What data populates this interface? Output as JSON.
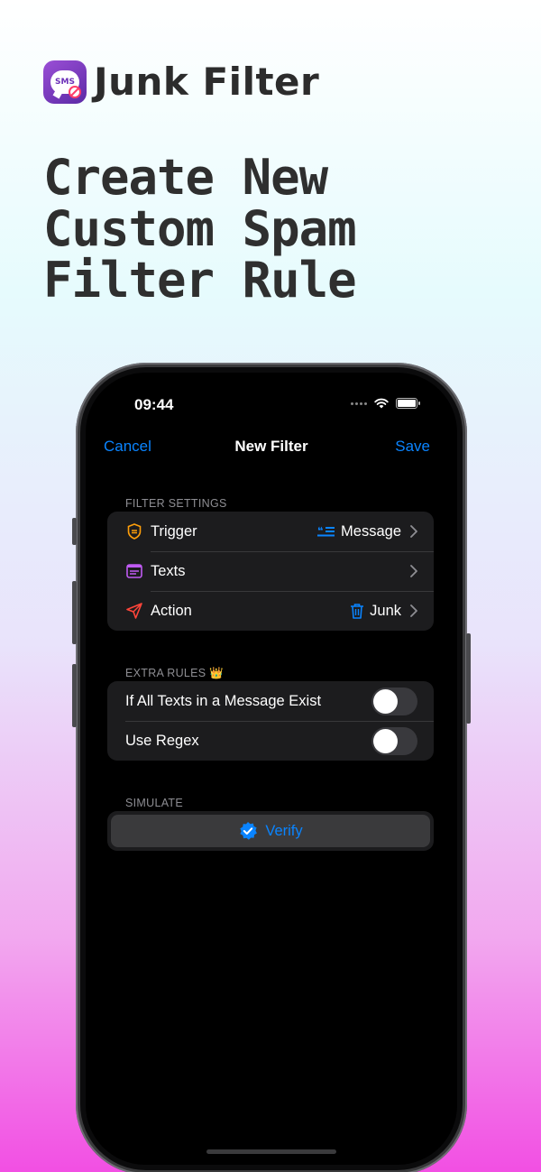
{
  "brand": {
    "name": "Junk Filter",
    "icon_text": "SMS"
  },
  "headline": [
    "Create New",
    "Custom Spam",
    "Filter Rule"
  ],
  "status": {
    "time": "09:44"
  },
  "nav": {
    "cancel": "Cancel",
    "title": "New Filter",
    "save": "Save"
  },
  "filter_settings": {
    "header": "FILTER SETTINGS",
    "rows": [
      {
        "label": "Trigger",
        "value": "Message",
        "icon": "shield-exclamation-icon",
        "value_icon": "quote-lines-icon"
      },
      {
        "label": "Texts",
        "value": "",
        "icon": "text-list-icon"
      },
      {
        "label": "Action",
        "value": "Junk",
        "icon": "paperplane-icon",
        "value_icon": "trash-icon"
      }
    ]
  },
  "extra_rules": {
    "header": "EXTRA RULES 👑",
    "rows": [
      {
        "label": "If All Texts in a Message Exist",
        "on": false
      },
      {
        "label": "Use Regex",
        "on": false
      }
    ]
  },
  "simulate": {
    "header": "SIMULATE",
    "button": "Verify"
  },
  "colors": {
    "accent": "#0a84ff",
    "trigger_icon": "#ff9f0a",
    "texts_icon": "#bf5af2",
    "action_icon": "#ff453a"
  }
}
